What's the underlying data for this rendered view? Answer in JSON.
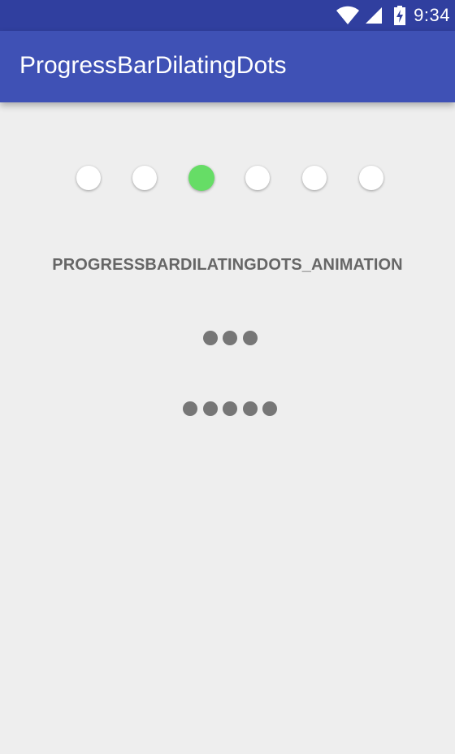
{
  "status_bar": {
    "time": "9:34",
    "background": "#303f9f",
    "icons": [
      "wifi-icon",
      "cell-signal-icon",
      "battery-charging-icon"
    ]
  },
  "app_bar": {
    "title": "ProgressBarDilatingDots",
    "background": "#3f51b5"
  },
  "dilating_dots": {
    "count": 6,
    "active_index": 2,
    "dot_color": "#ffffff",
    "active_color": "#66dd66"
  },
  "button": {
    "label": "PROGRESSBARDILATINGDOTS_ANIMATION",
    "text_color": "#666666"
  },
  "small_indicators": [
    {
      "dots": 3,
      "color": "#767676"
    },
    {
      "dots": 5,
      "color": "#767676"
    }
  ],
  "background": "#eeeeee"
}
